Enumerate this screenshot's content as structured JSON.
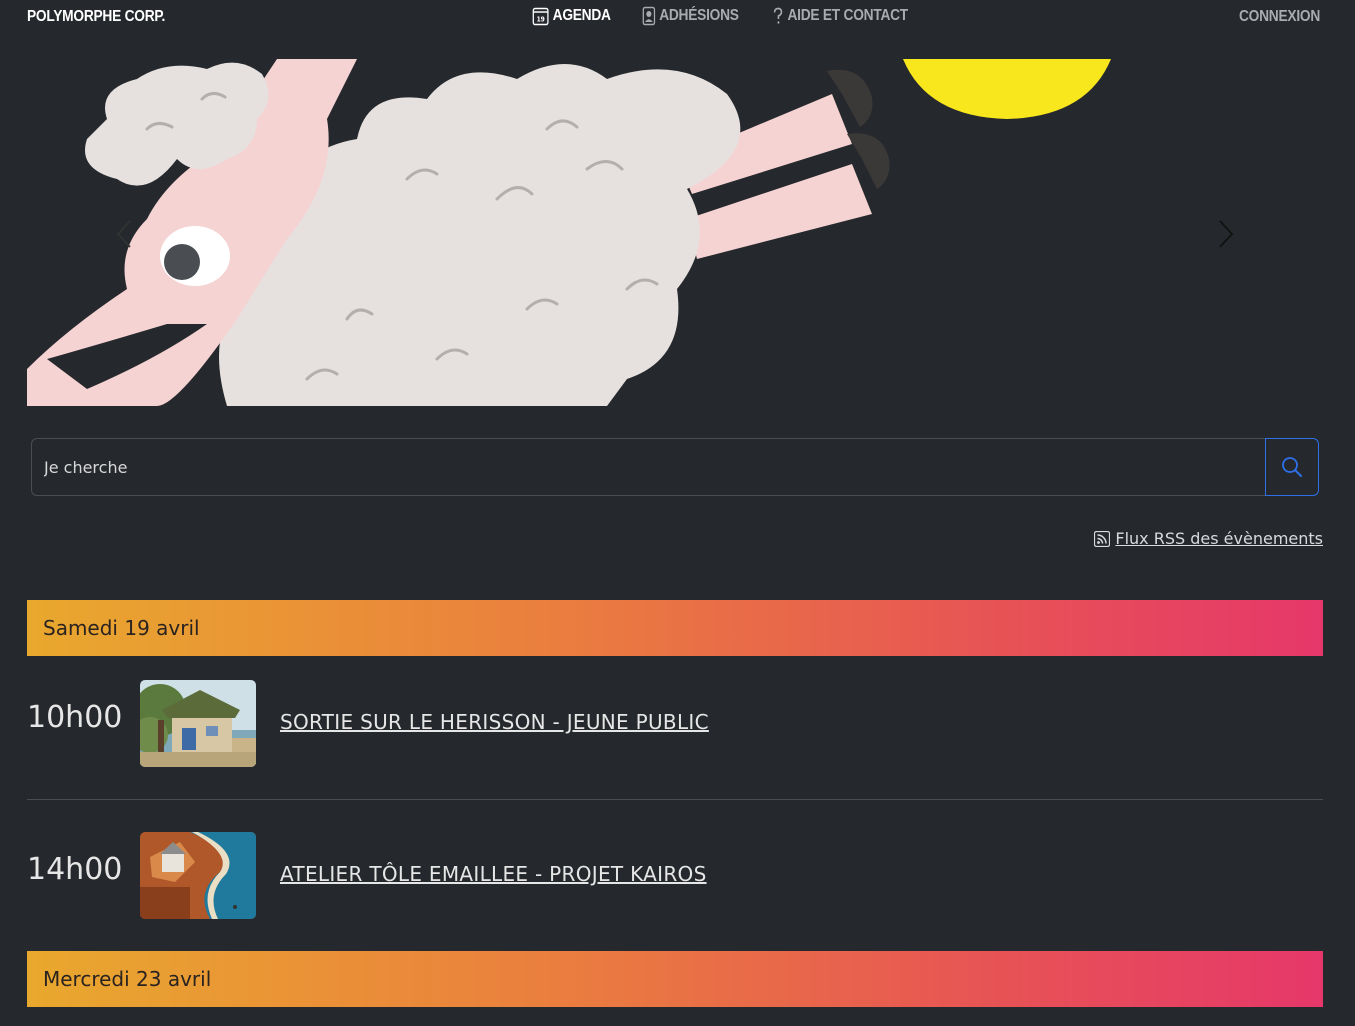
{
  "navbar": {
    "brand": "POLYMORPHE CORP.",
    "links": [
      {
        "label": "AGENDA",
        "icon": "calendar-icon",
        "badge": "19",
        "active": true
      },
      {
        "label": "ADHÉSIONS",
        "icon": "id-card-icon",
        "active": false
      },
      {
        "label": "AIDE ET CONTACT",
        "icon": "question-icon",
        "active": false
      }
    ],
    "login": "CONNEXION"
  },
  "carousel": {
    "prev_icon": "chevron-left-icon",
    "next_icon": "chevron-right-icon"
  },
  "search": {
    "placeholder": "Je cherche",
    "button_icon": "search-icon"
  },
  "rss": {
    "label": " Flux RSS des évènements",
    "icon": "rss-icon"
  },
  "days": [
    {
      "label": "Samedi 19 avril",
      "events": [
        {
          "time": "10h00",
          "title": "SORTIE SUR LE HERISSON - JEUNE PUBLIC"
        },
        {
          "time": "14h00",
          "title": "ATELIER TÔLE EMAILLEE - PROJET KAIROS"
        }
      ]
    },
    {
      "label": "Mercredi 23 avril",
      "events": []
    }
  ],
  "colors": {
    "background": "#25282c",
    "accent_blue": "#2f6fe8",
    "gradient_start": "#e9a82e",
    "gradient_end": "#e6376a",
    "sun_yellow": "#f9e71e"
  }
}
